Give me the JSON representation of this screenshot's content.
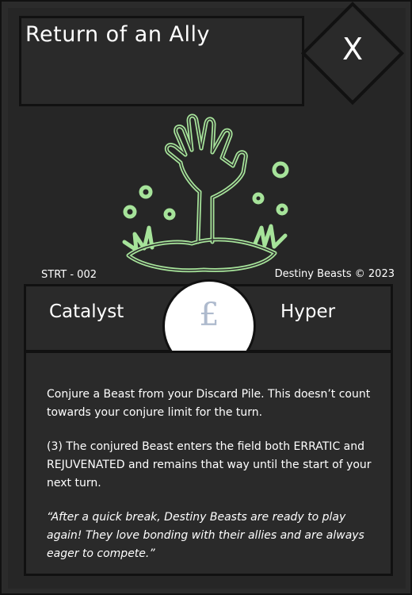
{
  "card": {
    "title": "Return of an Ally",
    "cost": "X",
    "set_code": "STRT - 002",
    "copyright": "Destiny Beasts © 2023",
    "type_left": "Catalyst",
    "type_right": "Hyper",
    "currency_symbol": "£",
    "rules_paragraph_1": "Conjure a Beast from your Discard Pile. This doesn’t count towards your conjure limit for the turn.",
    "rules_paragraph_2": "(3) The conjured Beast enters the field both ERRATIC and REJUVENATED and remains that way until the start of your next turn.",
    "flavor_text": "“After a quick break, Destiny Beasts are ready to play again! They love bonding with their allies and are always eager to compete.”"
  },
  "art": {
    "icon": "zombie-hand-icon",
    "stroke_color": "#a6e39a"
  },
  "colors": {
    "card_bg": "#262626",
    "panel_bg": "#2a2a2a",
    "border": "#111111",
    "text": "#ffffff",
    "currency": "#aebacd"
  }
}
